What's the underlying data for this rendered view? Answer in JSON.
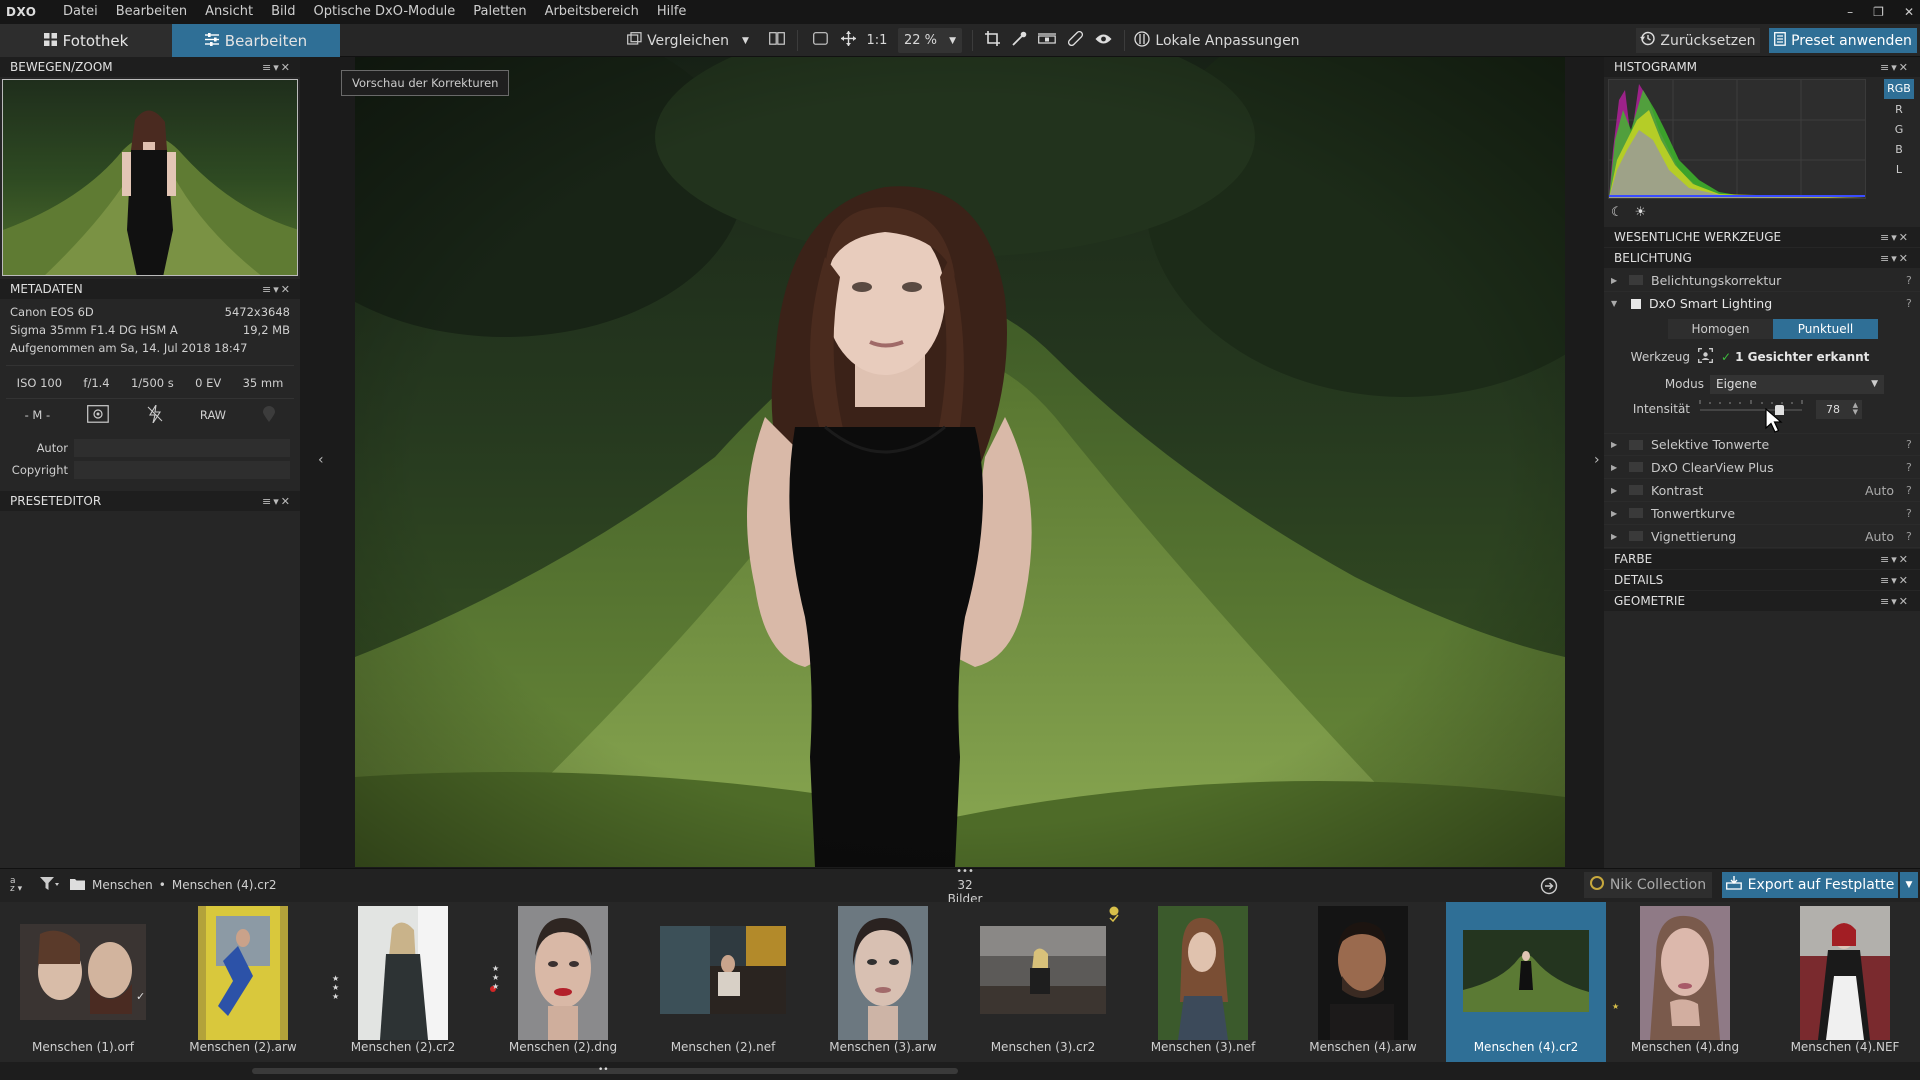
{
  "menubar": {
    "logo": "DXO",
    "items": [
      "Datei",
      "Bearbeiten",
      "Ansicht",
      "Bild",
      "Optische DxO-Module",
      "Paletten",
      "Arbeitsbereich",
      "Hilfe"
    ]
  },
  "window_controls": {
    "minimize": "–",
    "restore": "❐",
    "close": "✕"
  },
  "toolbar": {
    "tab_library": "Fotothek",
    "tab_edit": "Bearbeiten",
    "compare_label": "Vergleichen",
    "one_to_one": "1:1",
    "zoom_value": "22 %",
    "local_adjustments": "Lokale Anpassungen",
    "reset_label": "Zurücksetzen",
    "apply_preset": "Preset anwenden"
  },
  "left": {
    "move_zoom_title": "BEWEGEN/ZOOM",
    "metadata_title": "METADATEN",
    "camera": "Canon EOS 6D",
    "dimensions": "5472x3648",
    "lens": "Sigma 35mm F1.4 DG HSM A",
    "filesize": "19,2 MB",
    "taken": "Aufgenommen am Sa, 14. Jul 2018 18:47",
    "exif": [
      "ISO 100",
      "f/1.4",
      "1/500 s",
      "0 EV",
      "35 mm"
    ],
    "mode": "- M -",
    "raw": "RAW",
    "author_label": "Autor",
    "copyright_label": "Copyright",
    "preset_editor_title": "PRESETEDITOR"
  },
  "center": {
    "preview_label": "Vorschau der Korrekturen"
  },
  "right": {
    "histogram_title": "HISTOGRAMM",
    "channels": [
      "RGB",
      "R",
      "G",
      "B",
      "L"
    ],
    "essential_tools": "WESENTLICHE WERKZEUGE",
    "exposure_title": "BELICHTUNG",
    "exposure_correction": "Belichtungskorrektur",
    "smart_lighting": "DxO Smart Lighting",
    "mode_uniform": "Homogen",
    "mode_spot": "Punktuell",
    "tool_label": "Werkzeug",
    "faces_detected": "1 Gesichter erkannt",
    "mode_label": "Modus",
    "mode_value": "Eigene",
    "intensity_label": "Intensität",
    "intensity_value": "78",
    "intensity_level": 0.78,
    "selective_tones": "Selektive Tonwerte",
    "clearview": "DxO ClearView Plus",
    "contrast": "Kontrast",
    "contrast_value": "Auto",
    "tone_curve": "Tonwertkurve",
    "vignetting": "Vignettierung",
    "vignetting_value": "Auto",
    "color_title": "FARBE",
    "details_title": "DETAILS",
    "geometry_title": "GEOMETRIE",
    "help": "?"
  },
  "film": {
    "breadcrumb_folder": "Menschen",
    "breadcrumb_file": "Menschen (4).cr2",
    "count": "32 Bilder",
    "nik": "Nik Collection",
    "export": "Export auf Festplatte",
    "items": [
      {
        "name": "Menschen (1).orf",
        "stars": 0
      },
      {
        "name": "Menschen (2).arw",
        "stars": 0
      },
      {
        "name": "Menschen (2).cr2",
        "stars": 3
      },
      {
        "name": "Menschen (2).dng",
        "stars": 3
      },
      {
        "name": "Menschen (2).nef",
        "stars": 0
      },
      {
        "name": "Menschen (3).arw",
        "stars": 0
      },
      {
        "name": "Menschen (3).cr2",
        "stars": 0
      },
      {
        "name": "Menschen (3).nef",
        "stars": 0
      },
      {
        "name": "Menschen (4).arw",
        "stars": 0
      },
      {
        "name": "Menschen (4).cr2",
        "stars": 0
      },
      {
        "name": "Menschen (4).dng",
        "stars": 1
      },
      {
        "name": "Menschen (4).NEF",
        "stars": 0
      }
    ],
    "selected_index": 9
  },
  "colors": {
    "accent": "#2f6f96",
    "panel": "#262626",
    "header": "#1e1e1e"
  }
}
